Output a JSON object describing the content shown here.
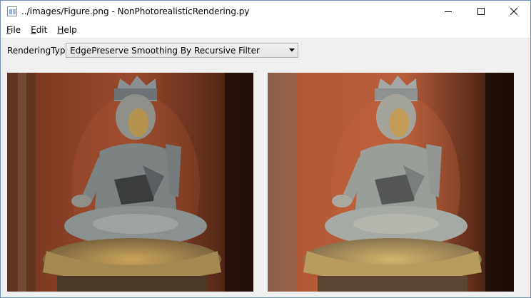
{
  "window": {
    "title": "../images/Figure.png - NonPhotorealisticRendering.py"
  },
  "menu": [
    {
      "prefix": "",
      "mnemonic": "F",
      "rest": "ile"
    },
    {
      "prefix": "",
      "mnemonic": "E",
      "rest": "dit"
    },
    {
      "prefix": "",
      "mnemonic": "H",
      "rest": "elp"
    }
  ],
  "toolbar": {
    "label": "RenderingType",
    "combo_value": "EdgePreserve Smoothing By Recursive Filter"
  },
  "images": {
    "left": "original-image",
    "right": "filtered-image"
  },
  "icons": {
    "app": "app-icon",
    "minimize": "minimize-icon",
    "maximize": "maximize-icon",
    "close": "close-icon",
    "combo_arrow": "chevron-down-icon"
  }
}
